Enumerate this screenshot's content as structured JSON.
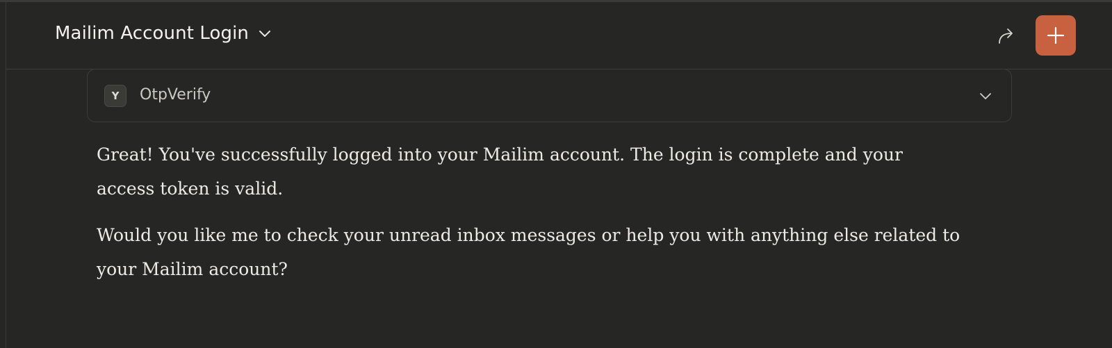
{
  "header": {
    "title": "Mailim Account Login"
  },
  "tool_call": {
    "badge": "Y",
    "name": "OtpVerify"
  },
  "message": {
    "paragraphs": [
      "Great! You've successfully logged into your Mailim account. The login is complete and your access token is valid.",
      "Would you like me to check your unread inbox messages or help you with anything else related to your Mailim account?"
    ]
  },
  "colors": {
    "background": "#262624",
    "accent": "#c8613f",
    "text": "#ecebe6"
  },
  "icons": {
    "title_dropdown": "chevron-down-icon",
    "share": "share-arrow-icon",
    "new_chat": "plus-icon",
    "tool_expand": "chevron-down-icon"
  }
}
